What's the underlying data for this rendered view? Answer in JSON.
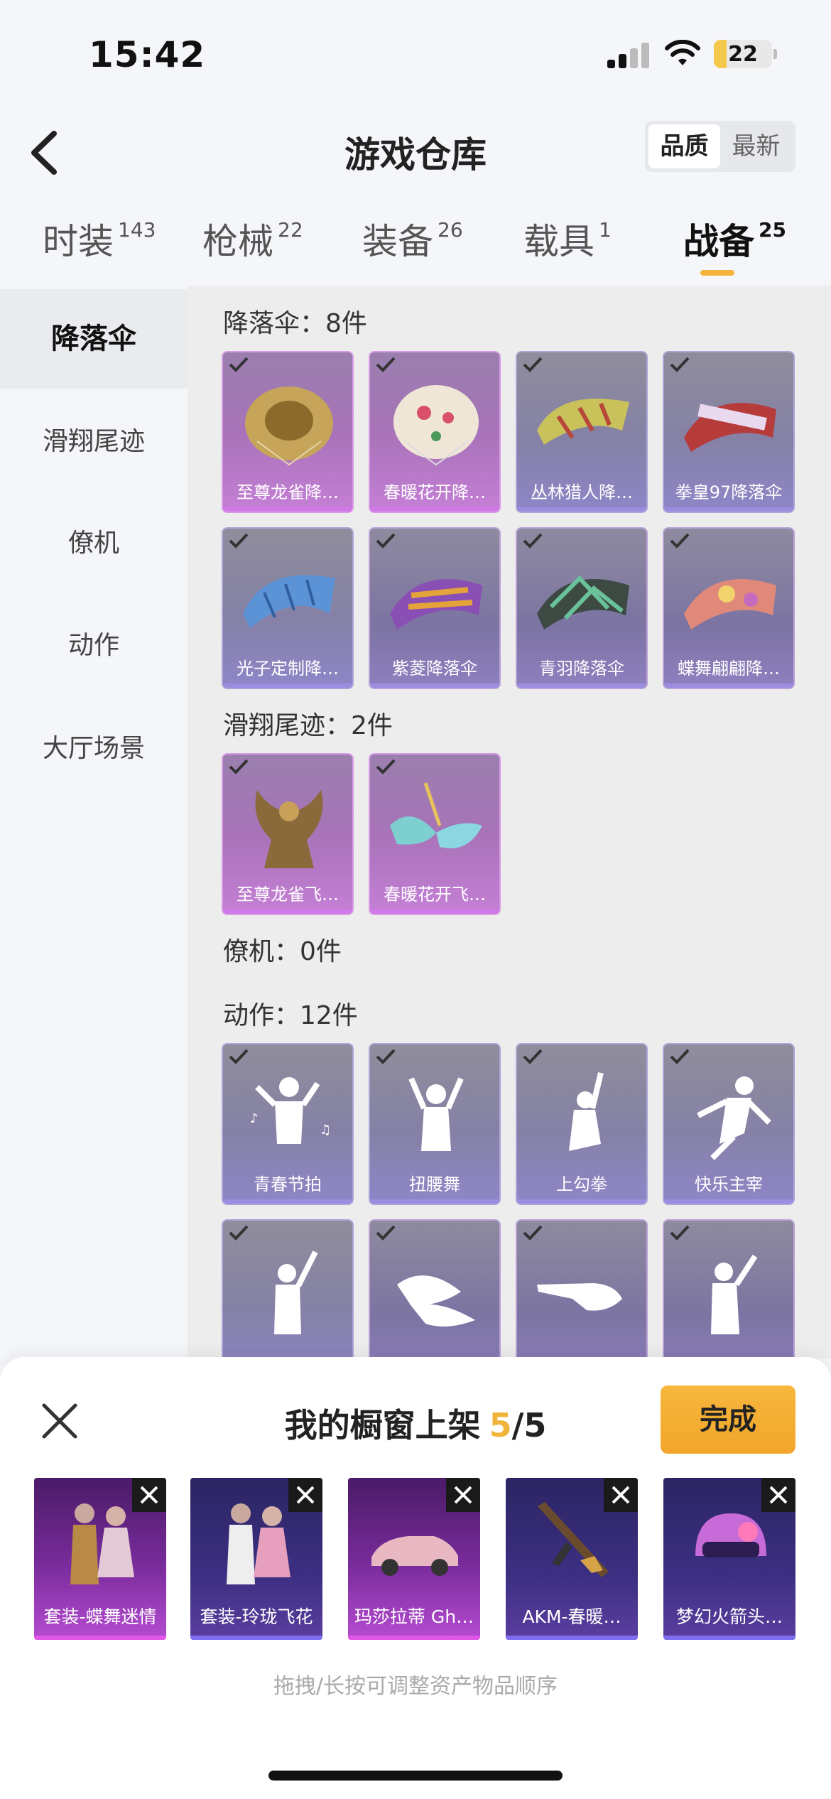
{
  "status_bar": {
    "time": "15:42",
    "battery": "22",
    "battery_level": 0.22
  },
  "nav": {
    "title": "游戏仓库",
    "sort_options": [
      "品质",
      "最新"
    ],
    "active_sort": 0
  },
  "tabs": [
    {
      "label": "时装",
      "count": "143"
    },
    {
      "label": "枪械",
      "count": "22"
    },
    {
      "label": "装备",
      "count": "26"
    },
    {
      "label": "载具",
      "count": "1"
    },
    {
      "label": "战备",
      "count": "25"
    }
  ],
  "active_tab": 4,
  "sidebar": {
    "items": [
      "降落伞",
      "滑翔尾迹",
      "僚机",
      "动作",
      "大厅场景"
    ],
    "active": 0
  },
  "sections": {
    "parachute": {
      "title": "降落伞：8件",
      "items": [
        "至尊龙雀降…",
        "春暖花开降…",
        "丛林猎人降…",
        "拳皇97降落伞",
        "光子定制降…",
        "紫菱降落伞",
        "青羽降落伞",
        "蝶舞翩翩降…"
      ]
    },
    "glide_trail": {
      "title": "滑翔尾迹：2件",
      "items": [
        "至尊龙雀飞…",
        "春暖花开飞…"
      ]
    },
    "wingman": {
      "title": "僚机：0件"
    },
    "emote": {
      "title": "动作：12件",
      "items": [
        "青春节拍",
        "扭腰舞",
        "上勾拳",
        "快乐主宰",
        "",
        "",
        "",
        ""
      ]
    }
  },
  "sheet": {
    "title": "我的橱窗上架",
    "count_current": "5",
    "count_total": "/5",
    "done_label": "完成",
    "items": [
      "套装-蝶舞迷情",
      "套装-玲珑飞花",
      "玛莎拉蒂 Gh…",
      "AKM-春暖…",
      "梦幻火箭头…"
    ],
    "hint": "拖拽/长按可调整资产物品顺序"
  },
  "colors": {
    "accent": "#f4b43a",
    "purple_rarity": "#d179e6",
    "blue_rarity": "#9b8de0"
  },
  "icons": [
    "back-icon",
    "check-icon",
    "close-icon",
    "remove-icon",
    "wifi-icon",
    "signal-icon"
  ]
}
